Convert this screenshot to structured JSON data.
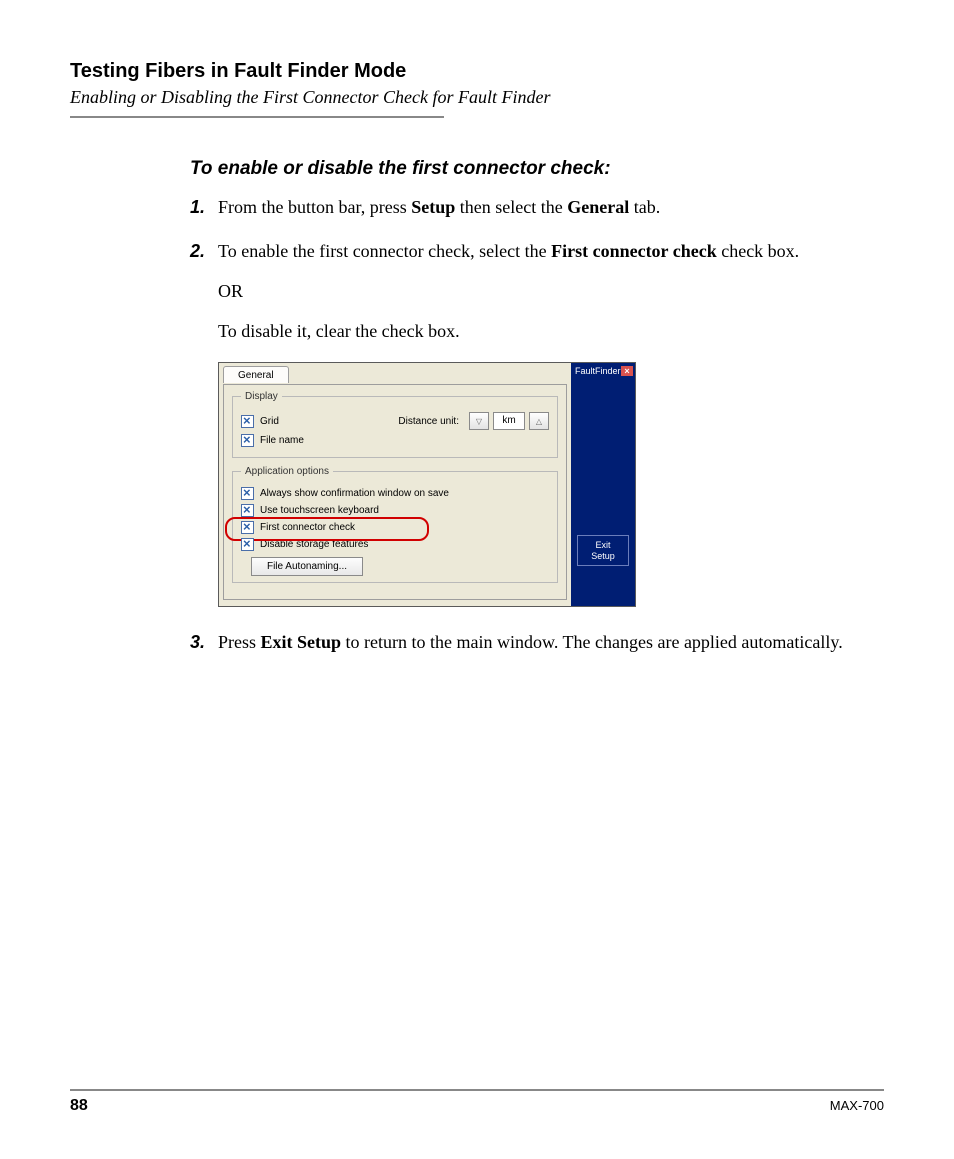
{
  "header": {
    "chapter_title": "Testing Fibers in Fault Finder Mode",
    "subtitle": "Enabling or Disabling the First Connector Check for Fault Finder"
  },
  "section_heading": "To enable or disable the first connector check:",
  "steps": {
    "s1": {
      "num": "1.",
      "pre": "From the button bar, press ",
      "bold1": "Setup",
      "mid": " then select the ",
      "bold2": "General",
      "post": " tab."
    },
    "s2": {
      "num": "2.",
      "line1_pre": "To enable the first connector check, select the ",
      "line1_bold": "First connector check",
      "line1_post": " check box.",
      "or": "OR",
      "line3": "To disable it, clear the check box."
    },
    "s3": {
      "num": "3.",
      "pre": "Press ",
      "bold": "Exit Setup",
      "post": " to return to the main window. The changes are applied automatically."
    }
  },
  "embedded_ui": {
    "tab_general": "General",
    "group_display": "Display",
    "cb_grid": "Grid",
    "distance_unit_label": "Distance unit:",
    "distance_unit_value": "km",
    "cb_filename": "File name",
    "group_app_options": "Application options",
    "cb_confirm_save": "Always show confirmation window on save",
    "cb_touch_keyboard": "Use touchscreen keyboard",
    "cb_first_connector": "First connector check",
    "cb_disable_storage": "Disable storage features",
    "btn_file_autoname": "File Autonaming...",
    "right_title": "FaultFinder",
    "btn_exit_setup": "Exit Setup"
  },
  "footer": {
    "page_number": "88",
    "model": "MAX-700"
  }
}
